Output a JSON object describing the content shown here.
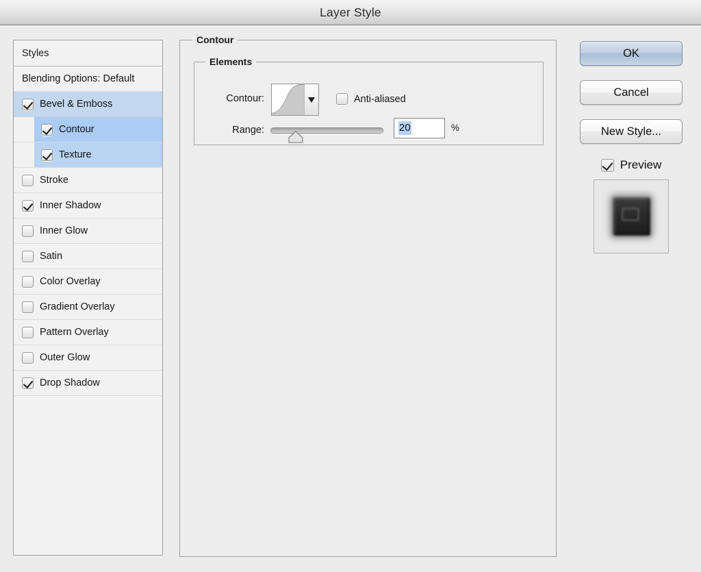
{
  "window": {
    "title": "Layer Style"
  },
  "styles_panel": {
    "header": "Styles",
    "blending_options": "Blending Options: Default",
    "items": [
      {
        "label": "Bevel & Emboss",
        "checked": true,
        "indent": false,
        "selected": true
      },
      {
        "label": "Contour",
        "checked": true,
        "indent": true,
        "selected": true
      },
      {
        "label": "Texture",
        "checked": true,
        "indent": true,
        "selected": true
      },
      {
        "label": "Stroke",
        "checked": false,
        "indent": false,
        "selected": false
      },
      {
        "label": "Inner Shadow",
        "checked": true,
        "indent": false,
        "selected": false
      },
      {
        "label": "Inner Glow",
        "checked": false,
        "indent": false,
        "selected": false
      },
      {
        "label": "Satin",
        "checked": false,
        "indent": false,
        "selected": false
      },
      {
        "label": "Color Overlay",
        "checked": false,
        "indent": false,
        "selected": false
      },
      {
        "label": "Gradient Overlay",
        "checked": false,
        "indent": false,
        "selected": false
      },
      {
        "label": "Pattern Overlay",
        "checked": false,
        "indent": false,
        "selected": false
      },
      {
        "label": "Outer Glow",
        "checked": false,
        "indent": false,
        "selected": false
      },
      {
        "label": "Drop Shadow",
        "checked": true,
        "indent": false,
        "selected": false
      }
    ]
  },
  "main_panel": {
    "group_title": "Contour",
    "elements": {
      "group_title": "Elements",
      "contour_label": "Contour:",
      "contour_preset_icon": "contour-curve-swatch",
      "dropdown_icon": "chevron-down-icon",
      "antialiased_label": "Anti-aliased",
      "antialiased_checked": false,
      "range_label": "Range:",
      "range_value": "20",
      "range_unit": "%",
      "range_percent": 20
    }
  },
  "buttons": {
    "ok": "OK",
    "cancel": "Cancel",
    "new_style": "New Style...",
    "preview_label": "Preview",
    "preview_checked": true
  },
  "preview_thumbnail": {
    "icon": "layer-preview-thumbnail"
  },
  "colors": {
    "selection_parent": "#c3d8f0",
    "selection_child": "#b9d3f2",
    "selection_active": "#aaccf5",
    "text_selection": "#b4d2f5",
    "default_button": "#a9bed7",
    "window_bg": "#ececec"
  }
}
